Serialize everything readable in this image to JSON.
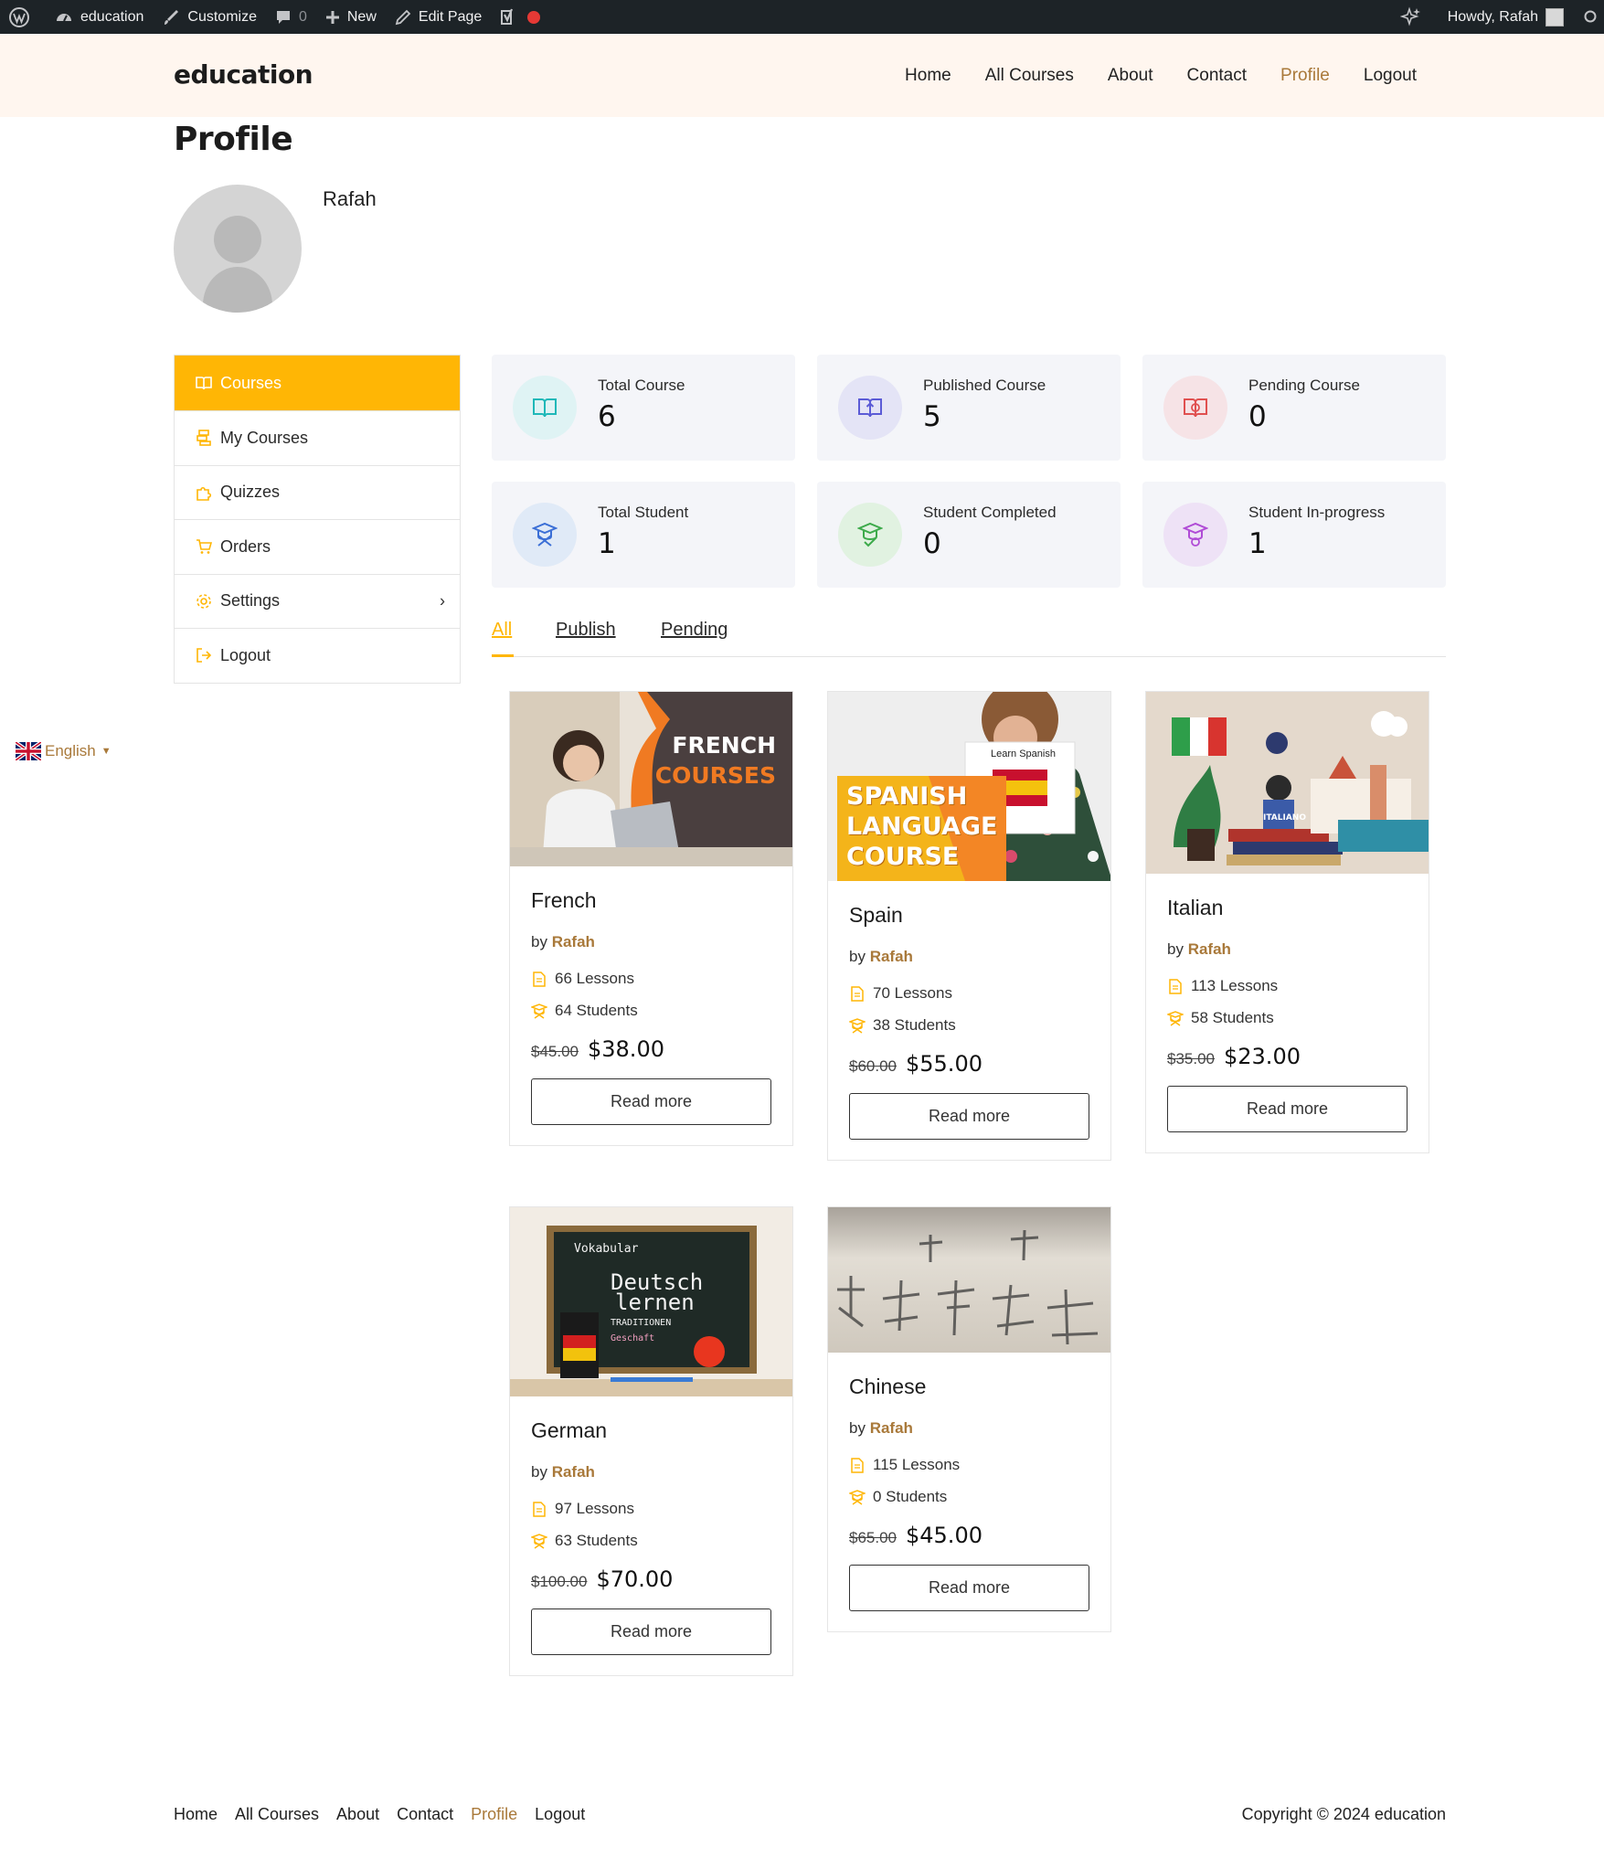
{
  "adminbar": {
    "site_name": "education",
    "customize": "Customize",
    "comments_count": "0",
    "new": "New",
    "edit_page": "Edit Page",
    "howdy": "Howdy, Rafah"
  },
  "header": {
    "logo": "education",
    "nav": [
      "Home",
      "All Courses",
      "About",
      "Contact",
      "Profile",
      "Logout"
    ],
    "active_nav": "Profile"
  },
  "profile": {
    "title": "Profile",
    "name": "Rafah"
  },
  "sidebar": {
    "items": [
      {
        "label": "Courses",
        "icon": "book-open-icon"
      },
      {
        "label": "My Courses",
        "icon": "stack-icon"
      },
      {
        "label": "Quizzes",
        "icon": "puzzle-icon"
      },
      {
        "label": "Orders",
        "icon": "cart-icon"
      },
      {
        "label": "Settings",
        "icon": "gear-icon"
      },
      {
        "label": "Logout",
        "icon": "logout-icon"
      }
    ]
  },
  "stats": [
    {
      "label": "Total Course",
      "value": "6",
      "icon": "book-icon",
      "color": "#1fb8b8",
      "bg": "#dff3f4"
    },
    {
      "label": "Published Course",
      "value": "5",
      "icon": "book-upload-icon",
      "color": "#5b5bd6",
      "bg": "#e4e4f6"
    },
    {
      "label": "Pending Course",
      "value": "0",
      "icon": "book-pending-icon",
      "color": "#e05050",
      "bg": "#f6e3e6"
    },
    {
      "label": "Total Student",
      "value": "1",
      "icon": "graduate-icon",
      "color": "#3b6fd6",
      "bg": "#e0eaf7"
    },
    {
      "label": "Student Completed",
      "value": "0",
      "icon": "graduate-check-icon",
      "color": "#3caa4a",
      "bg": "#e1f2e1"
    },
    {
      "label": "Student In-progress",
      "value": "1",
      "icon": "graduate-progress-icon",
      "color": "#b04bd6",
      "bg": "#eee2f6"
    }
  ],
  "tabs": [
    "All",
    "Publish",
    "Pending"
  ],
  "courses": [
    {
      "title": "French",
      "by": "by",
      "author": "Rafah",
      "lessons": "66 Lessons",
      "students": "64 Students",
      "old_price": "$45.00",
      "price": "$38.00",
      "cta": "Read more",
      "thumb_text": [
        "FRENCH",
        "COURSES"
      ]
    },
    {
      "title": "Spain",
      "by": "by",
      "author": "Rafah",
      "lessons": "70 Lessons",
      "students": "38 Students",
      "old_price": "$60.00",
      "price": "$55.00",
      "cta": "Read more",
      "thumb_text": [
        "SPANISH",
        "LANGUAGE",
        "COURSE"
      ],
      "thumb_badge": "Learn Spanish"
    },
    {
      "title": "Italian",
      "by": "by",
      "author": "Rafah",
      "lessons": "113 Lessons",
      "students": "58 Students",
      "old_price": "$35.00",
      "price": "$23.00",
      "cta": "Read more",
      "thumb_text": [
        "ITALIANO"
      ]
    },
    {
      "title": "German",
      "by": "by",
      "author": "Rafah",
      "lessons": "97 Lessons",
      "students": "63 Students",
      "old_price": "$100.00",
      "price": "$70.00",
      "cta": "Read more",
      "thumb_text": [
        "Deutsch",
        "lernen",
        "Vokabular",
        "TRADITIONEN",
        "Geschaft"
      ]
    },
    {
      "title": "Chinese",
      "by": "by",
      "author": "Rafah",
      "lessons": "115 Lessons",
      "students": "0 Students",
      "old_price": "$65.00",
      "price": "$45.00",
      "cta": "Read more"
    }
  ],
  "lang": {
    "label": "English"
  },
  "footer": {
    "links": [
      "Home",
      "All Courses",
      "About",
      "Contact",
      "Profile",
      "Logout"
    ],
    "copyright": "Copyright © 2024 education"
  },
  "colors": {
    "accent": "#ffb605",
    "link": "#a9793a",
    "admin_bar": "#1d2327",
    "header_bg": "#fff6ef"
  }
}
